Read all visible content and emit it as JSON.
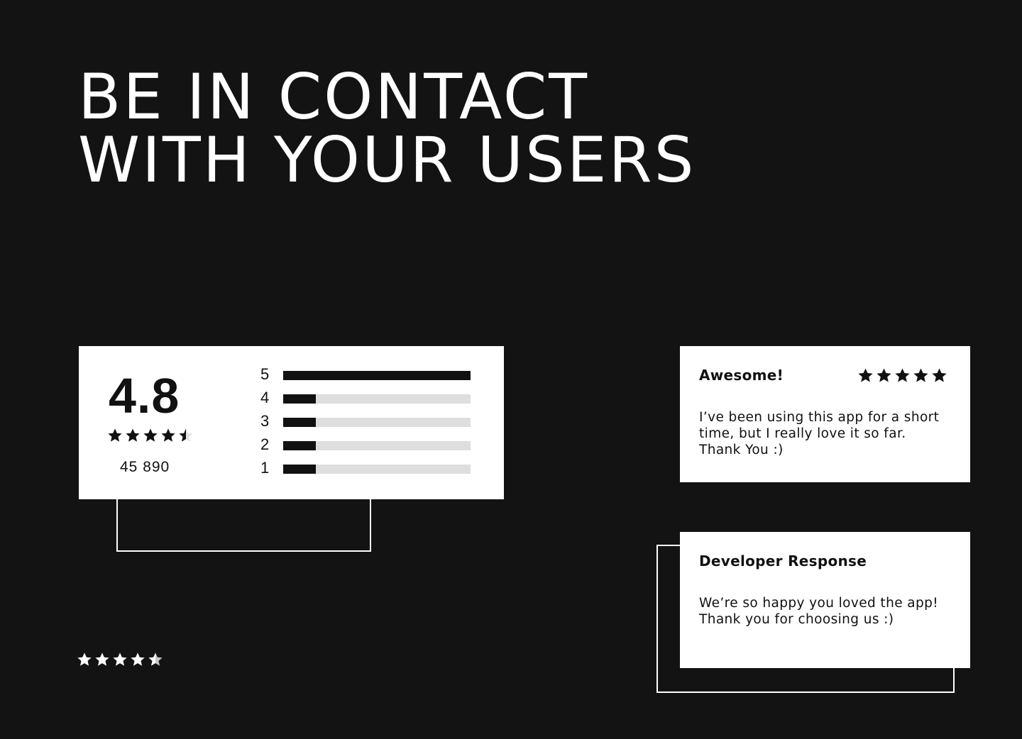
{
  "headline": {
    "line1": "BE IN CONTACT",
    "line2": "WITH YOUR USERS"
  },
  "rating_summary": {
    "score": "4.8",
    "stars": 4.5,
    "count": "45 890",
    "distribution": [
      {
        "label": "5",
        "fill": 1.0
      },
      {
        "label": "4",
        "fill": 0.175
      },
      {
        "label": "3",
        "fill": 0.175
      },
      {
        "label": "2",
        "fill": 0.175
      },
      {
        "label": "1",
        "fill": 0.175
      }
    ]
  },
  "review": {
    "title": "Awesome!",
    "stars": 5,
    "body": "I’ve been using this app for a short\ntime, but I really love it so far.\nThank You :)"
  },
  "developer_response": {
    "title": "Developer Response",
    "body": "We’re so happy you loved the app!\nThank you for choosing us :)"
  },
  "decorative_stars": {
    "stars": 4.5
  },
  "colors": {
    "background": "#131313",
    "card": "#ffffff",
    "ink": "#111111",
    "track": "#dedede"
  }
}
